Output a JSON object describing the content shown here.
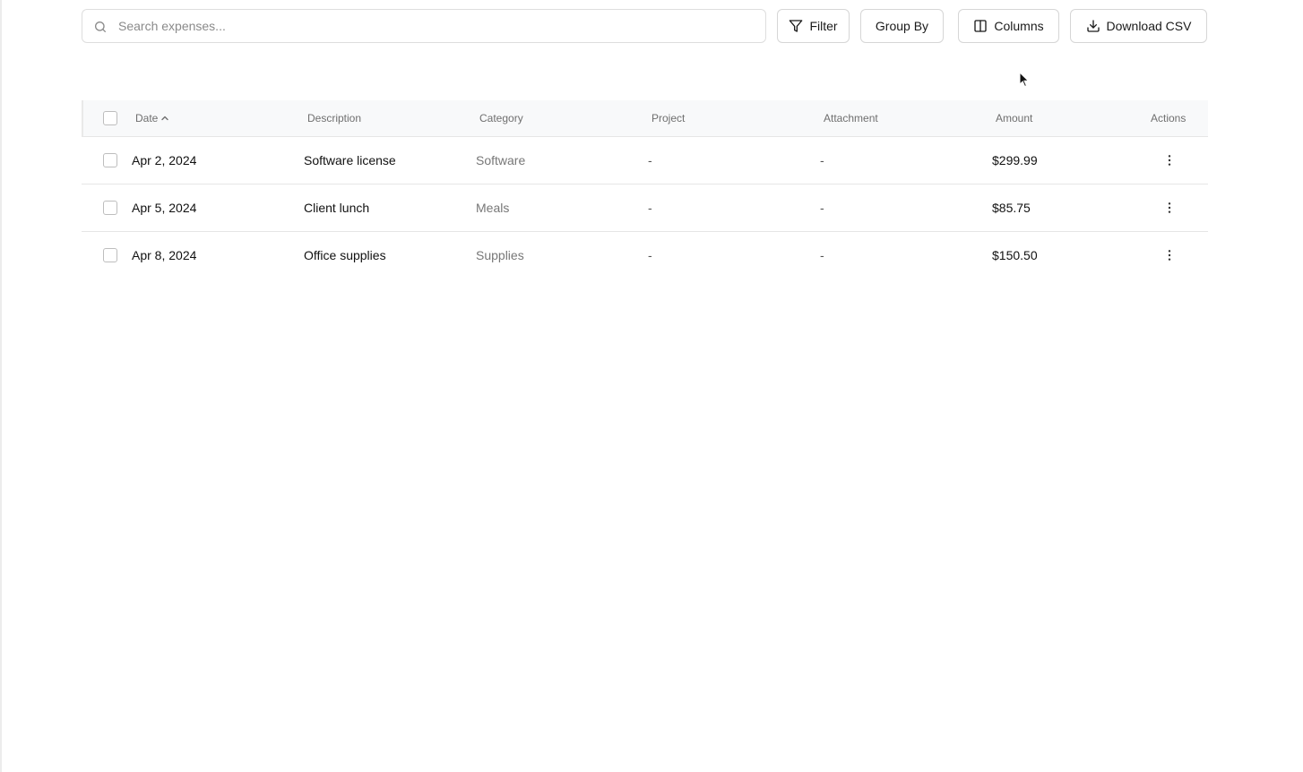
{
  "toolbar": {
    "search_placeholder": "Search expenses...",
    "search_value": "",
    "filter_label": "Filter",
    "group_by_label": "Group By",
    "columns_label": "Columns",
    "download_label": "Download CSV"
  },
  "table": {
    "headers": {
      "date": "Date",
      "description": "Description",
      "category": "Category",
      "project": "Project",
      "attachment": "Attachment",
      "amount": "Amount",
      "actions": "Actions"
    },
    "sort": {
      "column": "date",
      "direction": "ascending"
    },
    "rows": [
      {
        "date": "Apr 2, 2024",
        "description": "Software license",
        "category": "Software",
        "project": "-",
        "attachment": "-",
        "amount": "$299.99"
      },
      {
        "date": "Apr 5, 2024",
        "description": "Client lunch",
        "category": "Meals",
        "project": "-",
        "attachment": "-",
        "amount": "$85.75"
      },
      {
        "date": "Apr 8, 2024",
        "description": "Office supplies",
        "category": "Supplies",
        "project": "-",
        "attachment": "-",
        "amount": "$150.50"
      }
    ]
  },
  "icons": {
    "search": "search-icon",
    "filter": "filter-icon",
    "columns": "columns-icon",
    "download": "download-icon",
    "sort": "chevron-up-icon",
    "row_actions": "more-vertical-icon"
  },
  "colors": {
    "header_background": "#f8f9fa",
    "border": "#e6e6e6",
    "muted_text": "#777777"
  }
}
